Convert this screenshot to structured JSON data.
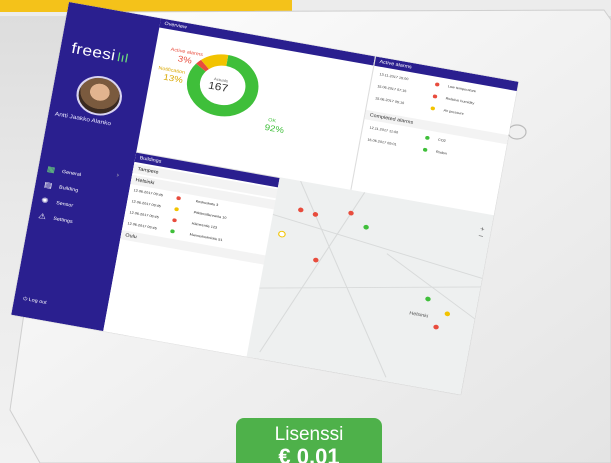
{
  "sidebar": {
    "logo": "freesi",
    "logo_bars": "lıl",
    "user_name": "Antti Jaakko Alanko",
    "nav": [
      {
        "label": "General",
        "icon": "grid-icon",
        "active": true
      },
      {
        "label": "Building",
        "icon": "building-icon",
        "active": false
      },
      {
        "label": "Sensor",
        "icon": "sensor-icon",
        "active": false
      },
      {
        "label": "Settings",
        "icon": "warning-icon",
        "active": false
      }
    ],
    "collapse_glyph": "›",
    "logout": "Log out"
  },
  "overview": {
    "title": "Overview",
    "active_alarms_label": "Active alarms",
    "active_alarms_value": "3%",
    "notification_label": "Notification",
    "notification_value": "13%",
    "ok_label": "OK",
    "ok_value": "92%",
    "center_label": "Actuals",
    "center_value": "167",
    "colors": {
      "ok": "#3fbf3a",
      "alarm": "#e84c3d",
      "notification": "#f2c300"
    },
    "ring": {
      "ok_pct": 84,
      "alarm_pct": 3,
      "notification_pct": 13
    }
  },
  "alarms": {
    "active_title": "Active alarms",
    "active_rows": [
      {
        "time": "13.11.2017 15:00",
        "color": "#e84c3d",
        "msg": "Low temperature"
      },
      {
        "time": "15.06.2017 07:15",
        "color": "#e84c3d",
        "msg": "Relative humidity"
      },
      {
        "time": "15.06.2017 05:10",
        "color": "#f2c300",
        "msg": "Air pressure"
      }
    ],
    "completed_title": "Completed alarms",
    "completed_rows": [
      {
        "time": "12.11.2017 11:00",
        "color": "#3fbf3a",
        "msg": "CO2"
      },
      {
        "time": "15.06.2017 09:01",
        "color": "#3fbf3a",
        "msg": "Radon"
      }
    ]
  },
  "buildings": {
    "title": "Buildings",
    "groups": [
      {
        "name": "Tampere",
        "rows": []
      },
      {
        "name": "Helsinki",
        "rows": [
          {
            "time": "12.06.2017 09:45",
            "color": "#e84c3d",
            "place": "Keskuskatu 3"
          },
          {
            "time": "12.06.2017 09:45",
            "color": "#f2c300",
            "place": "Pitkänsillanranta 10"
          },
          {
            "time": "12.06.2017 09:45",
            "color": "#e84c3d",
            "place": "Hämeentie 123"
          },
          {
            "time": "12.06.2017 09:45",
            "color": "#3fbf3a",
            "place": "Mannerheimintie 51"
          }
        ]
      },
      {
        "name": "Oulu",
        "rows": []
      }
    ]
  },
  "map": {
    "city_label": "Helsinki"
  },
  "license": {
    "line1": "Lisenssi",
    "line2": "€ 0,01"
  }
}
